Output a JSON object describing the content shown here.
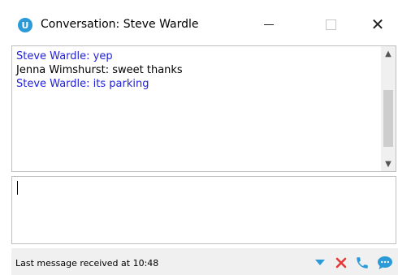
{
  "window": {
    "title": "Conversation: Steve Wardle",
    "app_icon_letter": "U"
  },
  "colors": {
    "accent": "#2a9bd8",
    "remote_message": "#1f1fd8",
    "local_message": "#000000",
    "cancel_red": "#e53935",
    "action_blue": "#2a9bd8"
  },
  "messages": [
    {
      "text": "Steve Wardle: yep",
      "sender": "remote"
    },
    {
      "text": "Jenna Wimshurst: sweet thanks",
      "sender": "local"
    },
    {
      "text": "Steve Wardle: its parking",
      "sender": "remote"
    }
  ],
  "compose": {
    "value": "",
    "placeholder": ""
  },
  "status": {
    "text": "Last message received at 10:48"
  },
  "icons": {
    "dropdown": "dropdown-arrow-icon",
    "cancel": "cancel-x-icon",
    "call": "phone-icon",
    "chat": "chat-bubble-icon"
  }
}
